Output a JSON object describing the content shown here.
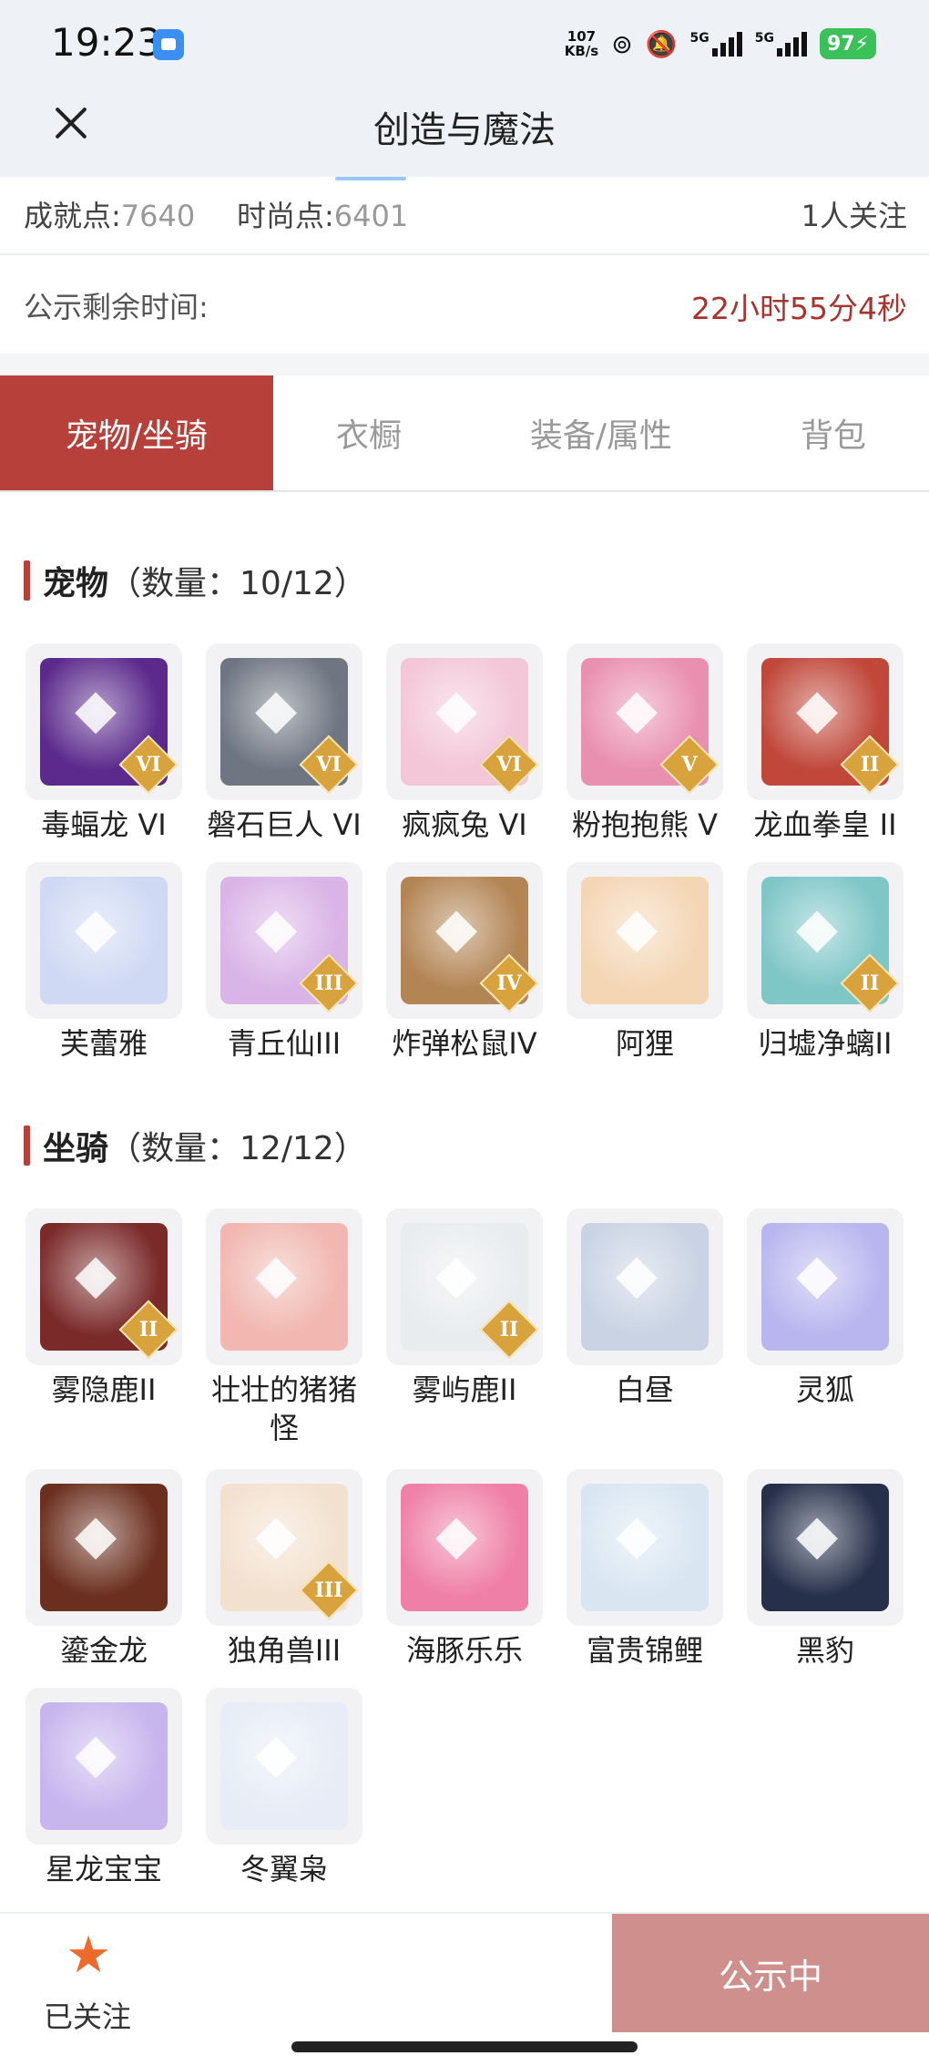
{
  "status_bar": {
    "time": "19:23",
    "speed_value": "107",
    "speed_unit": "KB/s",
    "net1": "5G",
    "net2": "5G",
    "battery": "97"
  },
  "header": {
    "title": "创造与魔法"
  },
  "stats": {
    "achievement_label": "成就点:",
    "achievement_value": "7640",
    "fashion_label": "时尚点:",
    "fashion_value": "6401",
    "followers": "1人关注"
  },
  "countdown": {
    "label": "公示剩余时间:",
    "value": "22小时55分4秒"
  },
  "tabs": [
    {
      "label": "宠物/坐骑"
    },
    {
      "label": "衣橱"
    },
    {
      "label": "装备/属性"
    },
    {
      "label": "背包"
    }
  ],
  "pets": {
    "title": "宠物",
    "count": "（数量：10/12）",
    "items": [
      {
        "name": "毒蝠龙 VI",
        "tier": "VI",
        "icon": "dragon-icon",
        "color": "#5b2a8c"
      },
      {
        "name": "磐石巨人 VI",
        "tier": "VI",
        "icon": "golem-icon",
        "color": "#6f7682"
      },
      {
        "name": "疯疯兔 VI",
        "tier": "VI",
        "icon": "rabbit-icon",
        "color": "#f3c6d8"
      },
      {
        "name": "粉抱抱熊 V",
        "tier": "V",
        "icon": "bear-icon",
        "color": "#e98fb0"
      },
      {
        "name": "龙血拳皇 II",
        "tier": "II",
        "icon": "beast-icon",
        "color": "#c0473a"
      },
      {
        "name": "芙蕾雅",
        "tier": "",
        "icon": "goddess-icon",
        "color": "#cfd9f3"
      },
      {
        "name": "青丘仙III",
        "tier": "III",
        "icon": "fox-fairy-icon",
        "color": "#d9b4e6"
      },
      {
        "name": "炸弹松鼠IV",
        "tier": "IV",
        "icon": "squirrel-icon",
        "color": "#b38555"
      },
      {
        "name": "阿狸",
        "tier": "",
        "icon": "fox-icon",
        "color": "#f4d6b5"
      },
      {
        "name": "归墟净螭II",
        "tier": "II",
        "icon": "water-dragon-icon",
        "color": "#7fc6c7"
      }
    ]
  },
  "mounts": {
    "title": "坐骑",
    "count": "（数量：12/12）",
    "items": [
      {
        "name": "雾隐鹿II",
        "tier": "II",
        "icon": "deer-icon",
        "color": "#7b2a2a"
      },
      {
        "name": "壮壮的猪猪怪",
        "tier": "",
        "icon": "pig-icon",
        "color": "#f1b7b0"
      },
      {
        "name": "雾屿鹿II",
        "tier": "II",
        "icon": "deer-icon",
        "color": "#e9ecef"
      },
      {
        "name": "白昼",
        "tier": "",
        "icon": "white-dragon-icon",
        "color": "#c9d3e3"
      },
      {
        "name": "灵狐",
        "tier": "",
        "icon": "spirit-fox-icon",
        "color": "#b9b6ef"
      },
      {
        "name": "鎏金龙",
        "tier": "",
        "icon": "golden-dragon-icon",
        "color": "#6b2f1f"
      },
      {
        "name": "独角兽III",
        "tier": "III",
        "icon": "unicorn-icon",
        "color": "#f3e1cf"
      },
      {
        "name": "海豚乐乐",
        "tier": "",
        "icon": "dolphin-icon",
        "color": "#ef7fa6"
      },
      {
        "name": "富贵锦鲤",
        "tier": "",
        "icon": "koi-icon",
        "color": "#d9e6f2"
      },
      {
        "name": "黑豹",
        "tier": "",
        "icon": "panther-icon",
        "color": "#26304a"
      },
      {
        "name": "星龙宝宝",
        "tier": "",
        "icon": "baby-dragon-icon",
        "color": "#c7b5ee"
      },
      {
        "name": "冬翼枭",
        "tier": "",
        "icon": "owl-icon",
        "color": "#e7ecf6"
      }
    ]
  },
  "bottom": {
    "followed_label": "已关注",
    "action_label": "公示中"
  },
  "colors": {
    "accent": "#b8403a",
    "countdown": "#a8342f",
    "star": "#ec6a2c",
    "action_bg": "#cf8f8d"
  }
}
